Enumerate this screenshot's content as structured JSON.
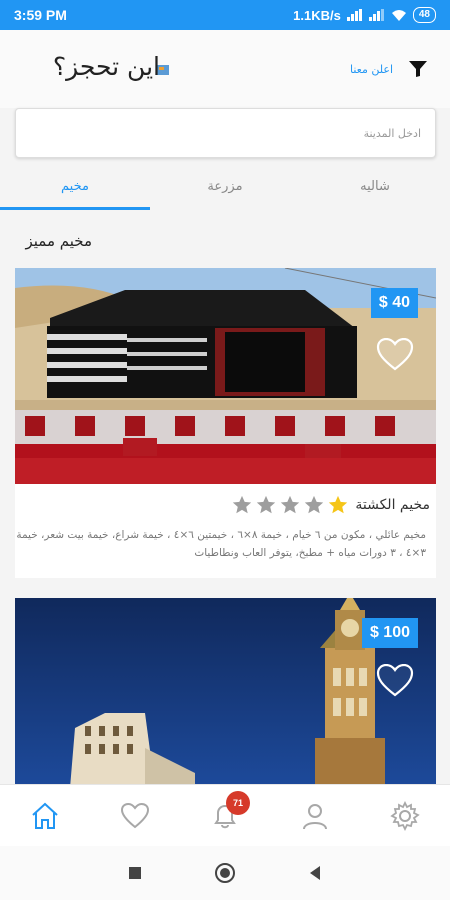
{
  "status_bar": {
    "time": "3:59 PM",
    "speed": "1.1KB/s",
    "battery": "48"
  },
  "header": {
    "title": "اين تحجز؟",
    "ad_link": "اعلن معنا"
  },
  "search": {
    "placeholder": "ادخل المدينة",
    "value": ""
  },
  "tabs": [
    {
      "label": "شاليه",
      "active": false
    },
    {
      "label": "مزرعة",
      "active": false
    },
    {
      "label": "مخيم",
      "active": true
    }
  ],
  "section_title": "مخيم مميز",
  "listings": [
    {
      "price": "$ 40",
      "title": "مخيم الكشتة",
      "rating": 1,
      "description": "مخيم عائلي ، مكون من ٦ خيام ، خيمة ٨×٦ ، خيمتين ٦×٤ ، خيمة شراع، خيمة بيت شعر، خيمة ٣×٤ ، ٣ دورات مياه + مطبخ، يتوفر العاب ونطاطيات"
    },
    {
      "price": "$ 100"
    }
  ],
  "bottom_nav": {
    "items": [
      "home-icon",
      "heart-icon",
      "bell-icon",
      "user-icon",
      "gear-icon"
    ],
    "notification_count": "71",
    "active_color": "#2196f3"
  },
  "colors": {
    "accent": "#2196f3",
    "badge": "#d63a2a",
    "star_active": "#f5c518",
    "star_inactive": "#9e9e9e"
  }
}
